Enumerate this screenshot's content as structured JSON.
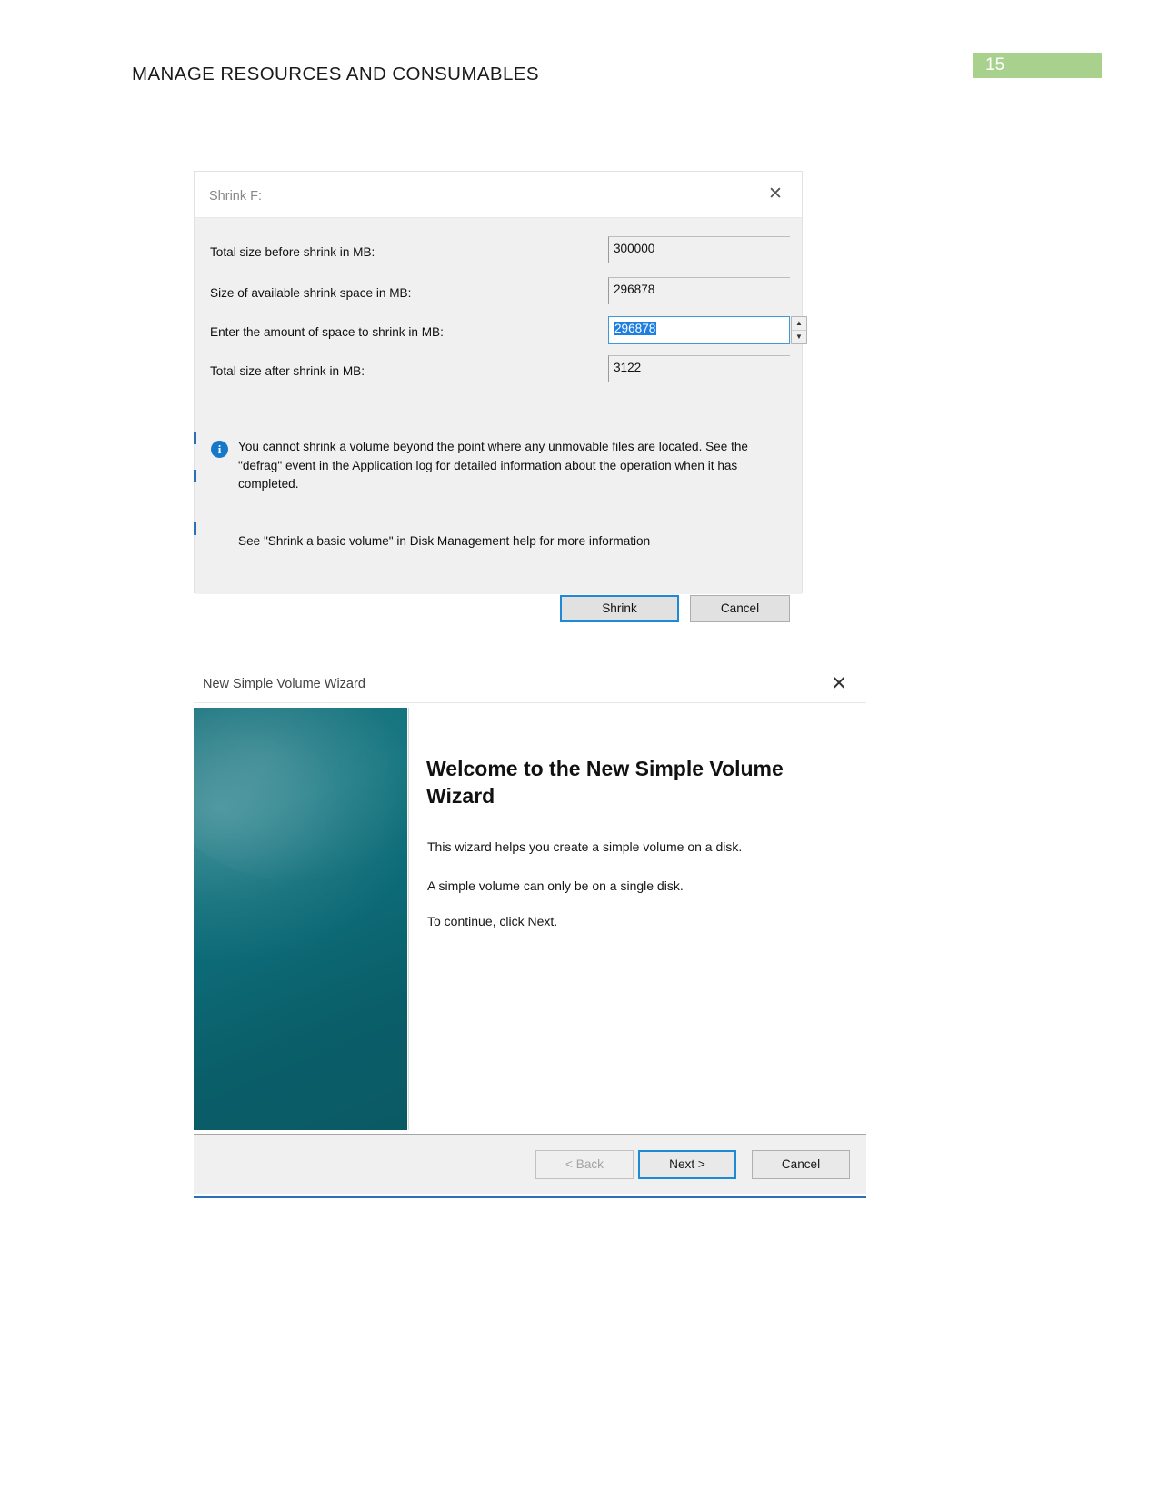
{
  "document": {
    "heading": "MANAGE RESOURCES AND CONSUMABLES",
    "page_number": "15",
    "badge_color": "#a9d18e"
  },
  "shrink_dialog": {
    "title": "Shrink F:",
    "close_icon": "✕",
    "rows": [
      {
        "label": "Total size before shrink in MB:",
        "value": "300000",
        "type": "readonly"
      },
      {
        "label": "Size of available shrink space in MB:",
        "value": "296878",
        "type": "readonly"
      },
      {
        "label": "Enter the amount of space to shrink in MB:",
        "value": "296878",
        "type": "editable"
      },
      {
        "label": "Total size after shrink in MB:",
        "value": "3122",
        "type": "readonly"
      }
    ],
    "spinner": {
      "up_icon": "▲",
      "down_icon": "▼"
    },
    "info_icon": "i",
    "info_text": "You cannot shrink a volume beyond the point where any unmovable files are located. See the \"defrag\" event in the Application log for detailed information about the operation when it has completed.",
    "help_text": "See \"Shrink a basic volume\" in Disk Management help for more information",
    "buttons": {
      "primary": "Shrink",
      "secondary": "Cancel"
    }
  },
  "wizard": {
    "title": "New Simple Volume Wizard",
    "close_icon": "✕",
    "heading": "Welcome to the New Simple Volume Wizard",
    "paragraphs": [
      "This wizard helps you create a simple volume on a disk.",
      "A simple volume can only be on a single disk.",
      "To continue, click Next."
    ],
    "buttons": {
      "back": "< Back",
      "next": "Next >",
      "cancel": "Cancel"
    }
  }
}
